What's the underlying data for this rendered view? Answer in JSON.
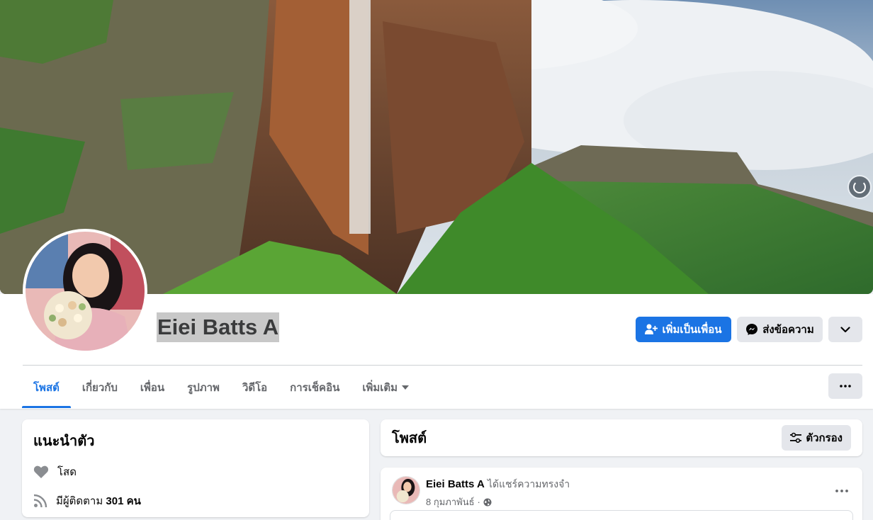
{
  "profile": {
    "name": "Eiei Batts A"
  },
  "actions": {
    "add_friend": "เพิ่มเป็นเพื่อน",
    "message": "ส่งข้อความ"
  },
  "tabs": [
    {
      "label": "โพสต์",
      "active": true
    },
    {
      "label": "เกี่ยวกับ",
      "active": false
    },
    {
      "label": "เพื่อน",
      "active": false
    },
    {
      "label": "รูปภาพ",
      "active": false
    },
    {
      "label": "วิดีโอ",
      "active": false
    },
    {
      "label": "การเช็คอิน",
      "active": false
    },
    {
      "label": "เพิ่มเติม",
      "active": false
    }
  ],
  "intro": {
    "title": "แนะนำตัว",
    "relationship": "โสด",
    "followers_prefix": "มีผู้ติดตาม",
    "followers_count": "301",
    "followers_suffix": "คน"
  },
  "posts": {
    "title": "โพสต์",
    "filter_label": "ตัวกรอง"
  },
  "post": {
    "author": "Eiei Batts A",
    "action": "ได้แชร์ความทรงจำ",
    "date": "8 กุมภาพันธ์",
    "separator": "·"
  },
  "colors": {
    "accent": "#1b74e4",
    "background": "#f0f2f5",
    "secondary_button": "#e4e6eb"
  }
}
